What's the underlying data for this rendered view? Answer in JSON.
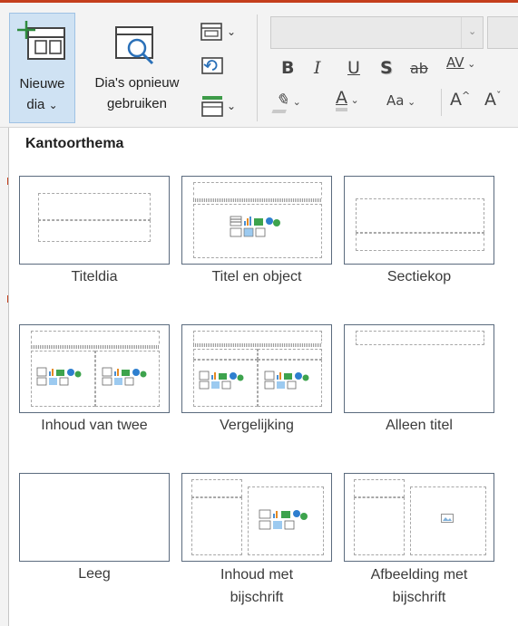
{
  "ribbon": {
    "new_slide": {
      "line1": "Nieuwe",
      "line2": "dia",
      "chevron": "⌄"
    },
    "reuse_slides": {
      "line1": "Dia's opnieuw",
      "line2": "gebruiken"
    },
    "format": {
      "bold": "B",
      "italic": "I",
      "underline": "U",
      "shadow": "S",
      "strike": "ab",
      "spacing": "AV",
      "case": "Aa",
      "grow": "A",
      "shrink": "A"
    }
  },
  "panel": {
    "title": "Kantoorthema",
    "layouts": [
      {
        "caption": "Titeldia"
      },
      {
        "caption": "Titel en object"
      },
      {
        "caption": "Sectiekop"
      },
      {
        "caption": "Inhoud van twee"
      },
      {
        "caption": "Vergelijking"
      },
      {
        "caption": "Alleen titel"
      },
      {
        "caption": "Leeg"
      },
      {
        "caption_line1": "Inhoud met",
        "caption_line2": "bijschrift"
      },
      {
        "caption_line1": "Afbeelding met",
        "caption_line2": "bijschrift"
      }
    ]
  },
  "colors": {
    "accent": "#c43e1c",
    "selected_bg": "#cfe2f3",
    "thumb_border": "#5b6b7e"
  },
  "icons": [
    "new-slide-icon",
    "reuse-slides-icon",
    "layout-icon",
    "reset-icon",
    "section-icon",
    "chevron-down-icon",
    "content-placeholder-icon",
    "picture-placeholder-icon"
  ]
}
